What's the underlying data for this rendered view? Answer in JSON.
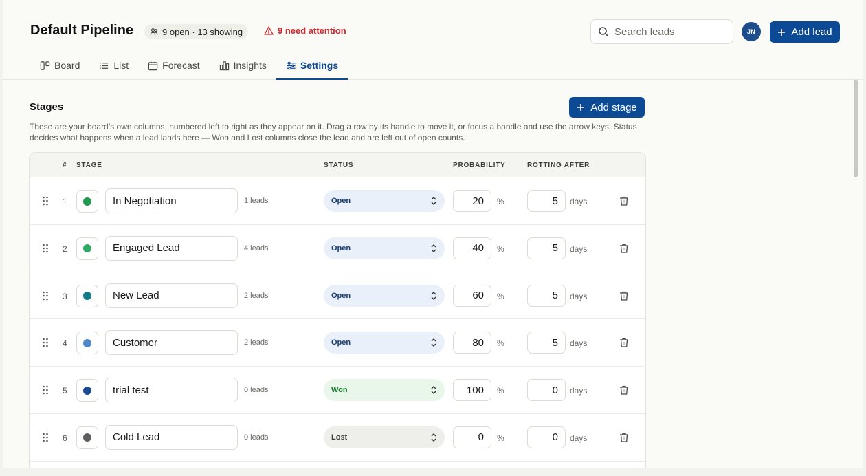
{
  "header": {
    "title": "Default Pipeline",
    "summary_pill": "9 open · 13 showing",
    "attention": "9 need attention",
    "search_placeholder": "Search leads",
    "avatar_initials": "JN",
    "add_lead_label": "Add lead"
  },
  "tabs": [
    {
      "label": "Board",
      "icon": "board-icon",
      "active": false
    },
    {
      "label": "List",
      "icon": "list-icon",
      "active": false
    },
    {
      "label": "Forecast",
      "icon": "calendar-icon",
      "active": false
    },
    {
      "label": "Insights",
      "icon": "bar-chart-icon",
      "active": false
    },
    {
      "label": "Settings",
      "icon": "sliders-icon",
      "active": true
    }
  ],
  "stages": {
    "title": "Stages",
    "add_stage_label": "Add stage",
    "description": "These are your board’s own columns, numbered left to right as they appear on it. Drag a row by its handle to move it, or focus a handle and use the arrow keys. Status decides what happens when a lead lands here — Won and Lost columns close the lead and are left out of open counts.",
    "columns": {
      "number": "#",
      "stage": "STAGE",
      "status": "STATUS",
      "probability": "PROBABILITY",
      "rotting_after": "ROTTING AFTER"
    },
    "percent_unit": "%",
    "days_unit": "days",
    "rows": [
      {
        "number": "1",
        "color": "#1f9a4c",
        "name": "In Negotiation",
        "count": "1 leads",
        "status": "Open",
        "status_kind": "open",
        "probability": "20",
        "rotting": "5"
      },
      {
        "number": "2",
        "color": "#2fa864",
        "name": "Engaged Lead",
        "count": "4 leads",
        "status": "Open",
        "status_kind": "open",
        "probability": "40",
        "rotting": "5"
      },
      {
        "number": "3",
        "color": "#117a86",
        "name": "New Lead",
        "count": "2 leads",
        "status": "Open",
        "status_kind": "open",
        "probability": "60",
        "rotting": "5"
      },
      {
        "number": "4",
        "color": "#4e86c8",
        "name": "Customer",
        "count": "2 leads",
        "status": "Open",
        "status_kind": "open",
        "probability": "80",
        "rotting": "5"
      },
      {
        "number": "5",
        "color": "#1b4b8e",
        "name": "trial test",
        "count": "0 leads",
        "status": "Won",
        "status_kind": "won",
        "probability": "100",
        "rotting": "0"
      },
      {
        "number": "6",
        "color": "#5f5f5f",
        "name": "Cold Lead",
        "count": "0 leads",
        "status": "Lost",
        "status_kind": "lost",
        "probability": "0",
        "rotting": "0"
      }
    ]
  },
  "colors": {
    "accent": "#0d4a96",
    "attention": "#d3262e",
    "background": "#fafaf6"
  }
}
